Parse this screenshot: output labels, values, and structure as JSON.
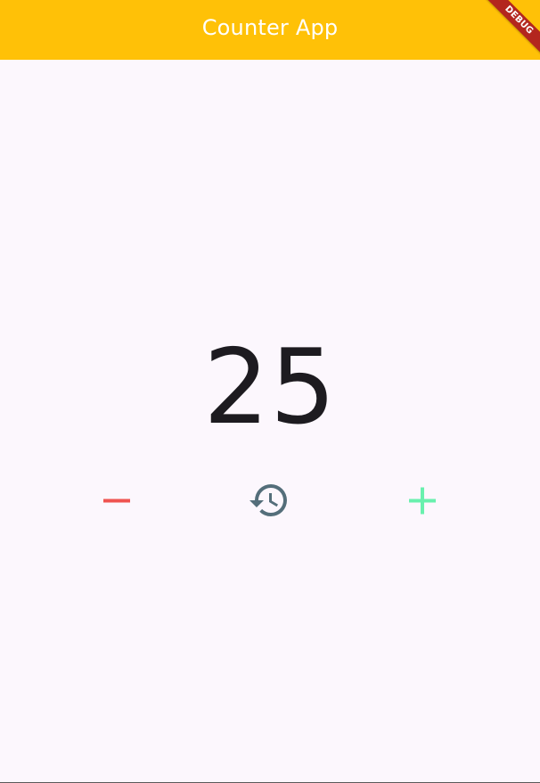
{
  "app_bar": {
    "title": "Counter App",
    "color": "#FFC107"
  },
  "debug_banner": {
    "label": "DEBUG",
    "color": "#B3261E"
  },
  "counter": {
    "value": "25"
  },
  "controls": {
    "decrement": {
      "icon": "minus-icon",
      "color": "#EF5350"
    },
    "reset": {
      "icon": "history-icon",
      "color": "#546E7A"
    },
    "increment": {
      "icon": "plus-icon",
      "color": "#69F0AE"
    }
  }
}
